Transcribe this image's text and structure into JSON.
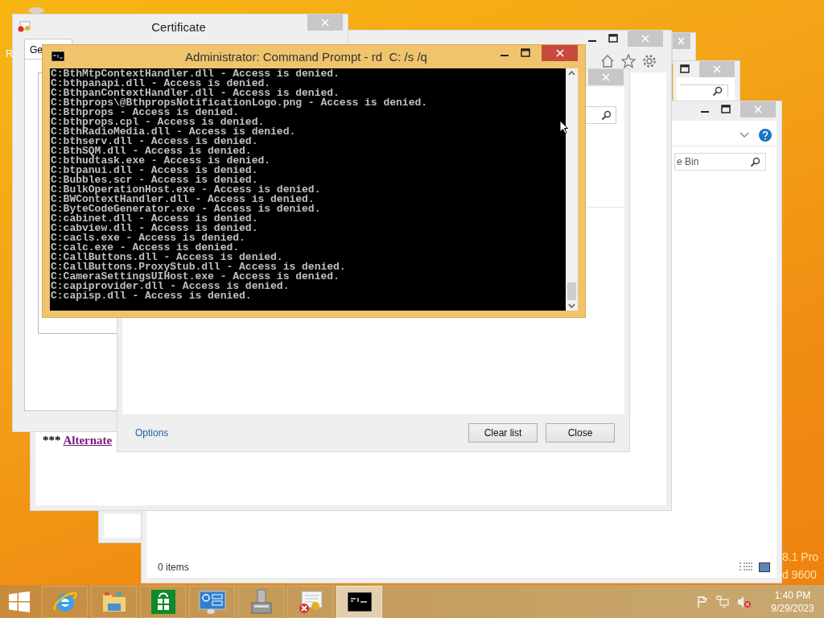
{
  "desktop": {
    "icon_label": "R",
    "edition_lines": [
      "8.1 Pro",
      "d 9600"
    ]
  },
  "recycle_bin_window": {
    "search_text": "e Bin",
    "status": "0 items"
  },
  "browser_window": {
    "page_text_prefix": "***",
    "page_link": "Alternate"
  },
  "history_dialog": {
    "options_link": "Options",
    "buttons": [
      "Clear list",
      "Close"
    ]
  },
  "certificate_dialog": {
    "title": "Certificate",
    "tab": "Ge"
  },
  "console_window": {
    "title": "Administrator: Command Prompt - rd  C: /s /q",
    "lines": [
      "C:BthMtpContextHandler.dll - Access is denied.",
      "C:bthpanapi.dll - Access is denied.",
      "C:BthpanContextHandler.dll - Access is denied.",
      "C:Bthprops\\@BthpropsNotificationLogo.png - Access is denied.",
      "C:Bthprops - Access is denied.",
      "C:bthprops.cpl - Access is denied.",
      "C:BthRadioMedia.dll - Access is denied.",
      "C:bthserv.dll - Access is denied.",
      "C:BthSQM.dll - Access is denied.",
      "C:bthudtask.exe - Access is denied.",
      "C:btpanui.dll - Access is denied.",
      "C:Bubbles.scr - Access is denied.",
      "C:BulkOperationHost.exe - Access is denied.",
      "C:BWContextHandler.dll - Access is denied.",
      "C:ByteCodeGenerator.exe - Access is denied.",
      "C:cabinet.dll - Access is denied.",
      "C:cabview.dll - Access is denied.",
      "C:cacls.exe - Access is denied.",
      "C:calc.exe - Access is denied.",
      "C:CallButtons.dll - Access is denied.",
      "C:CallButtons.ProxyStub.dll - Access is denied.",
      "C:CameraSettingsUIHost.exe - Access is denied.",
      "C:capiprovider.dll - Access is denied.",
      "C:capisp.dll - Access is denied."
    ]
  },
  "taskbar": {
    "buttons": [
      {
        "kind": "start",
        "selected": false
      },
      {
        "kind": "browser",
        "selected": false
      },
      {
        "kind": "explorer",
        "selected": false
      },
      {
        "kind": "store",
        "selected": false
      },
      {
        "kind": "control_panel",
        "selected": false
      },
      {
        "kind": "tool",
        "selected": false
      },
      {
        "kind": "certificate",
        "selected": false
      },
      {
        "kind": "console",
        "selected": true
      }
    ],
    "clock": {
      "time": "1:40 PM",
      "date": "9/29/2023"
    }
  }
}
